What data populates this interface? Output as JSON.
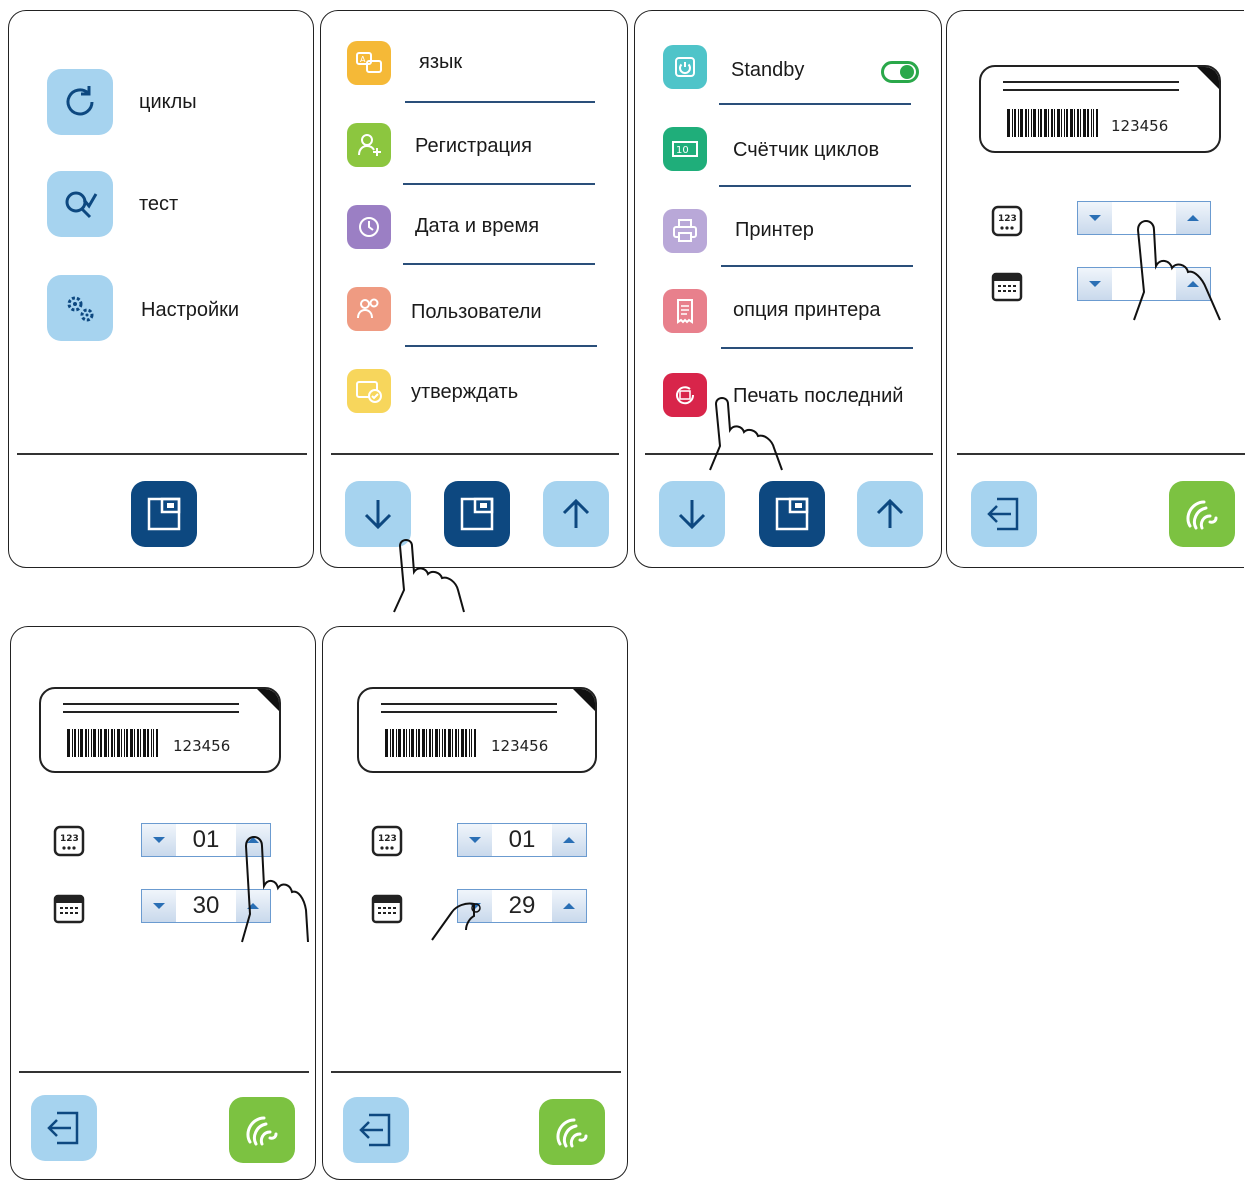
{
  "screen1": {
    "items": [
      {
        "label": "циклы",
        "icon": "cycles-icon"
      },
      {
        "label": "тест",
        "icon": "test-icon"
      },
      {
        "label": "Настройки",
        "icon": "settings-icon"
      }
    ]
  },
  "screen2": {
    "items": [
      {
        "label": "язык",
        "icon": "language-icon",
        "color": "#f5b937"
      },
      {
        "label": "Регистрация",
        "icon": "registration-icon",
        "color": "#8cc63f"
      },
      {
        "label": "Дата и время",
        "icon": "clock-icon",
        "color": "#9b7fc4"
      },
      {
        "label": "Пользователи",
        "icon": "users-icon",
        "color": "#ef9b82"
      },
      {
        "label": "утверждать",
        "icon": "approve-icon",
        "color": "#f7d65c"
      }
    ]
  },
  "screen3": {
    "items": [
      {
        "label": "Standby",
        "icon": "power-icon",
        "color": "#4fc4c9"
      },
      {
        "label": "Счётчик циклов",
        "icon": "counter-icon",
        "color": "#1fae7a"
      },
      {
        "label": "Принтер",
        "icon": "printer-icon",
        "color": "#b9a8d8"
      },
      {
        "label": "опция принтера",
        "icon": "receipt-icon",
        "color": "#e8808c"
      },
      {
        "label": "Печать последний",
        "icon": "print-last-icon",
        "color": "#d8254a"
      }
    ],
    "standby_toggle": "on",
    "toggle_color": "#2aa84a"
  },
  "label_preview": {
    "code": "123456"
  },
  "screen4": {
    "copies": "",
    "date": ""
  },
  "screen5": {
    "copies": "01",
    "date": "30"
  },
  "screen6": {
    "copies": "01",
    "date": "29"
  },
  "colors": {
    "tile_light": "#a6d3ef",
    "tile_dark": "#0d4880",
    "tile_green": "#7cc241"
  }
}
